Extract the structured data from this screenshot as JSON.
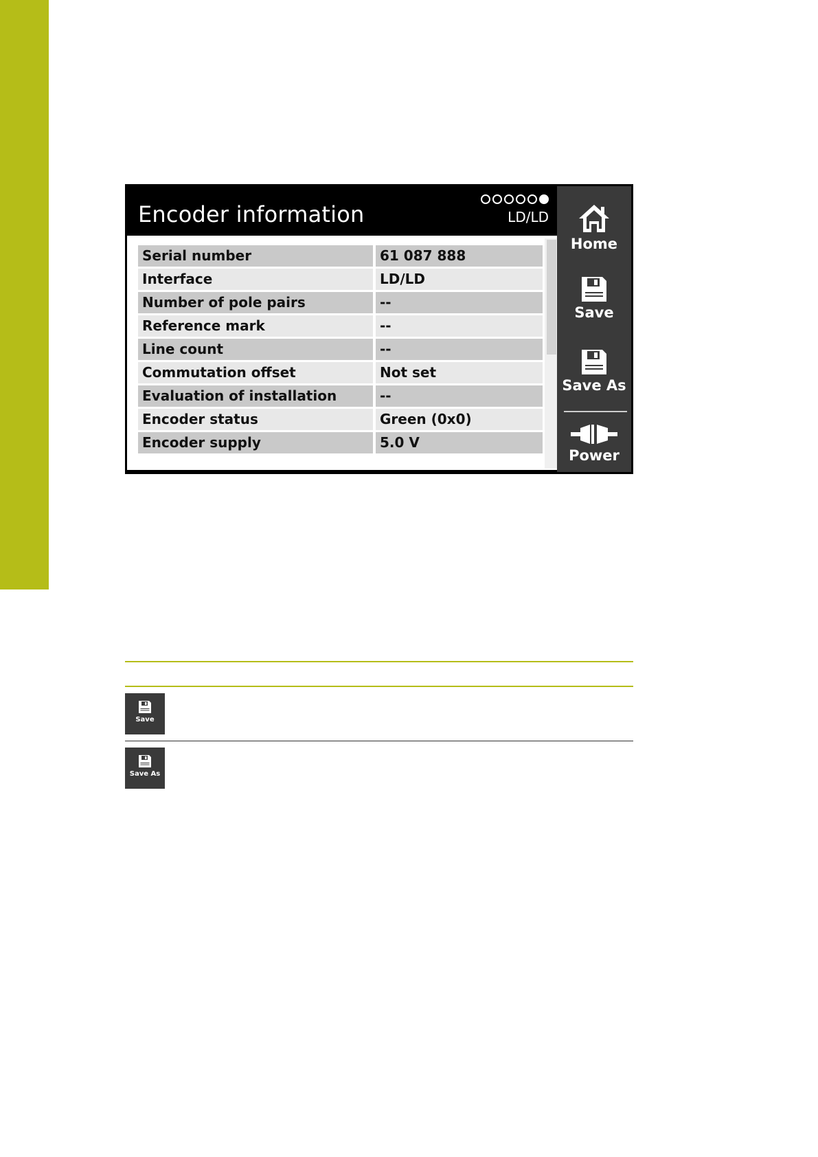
{
  "screen": {
    "title": "Encoder information",
    "interface_label": "LD/LD",
    "page_indicator": {
      "total": 6,
      "current": 6
    },
    "rows": [
      {
        "label": "Serial number",
        "value": "61 087 888"
      },
      {
        "label": "Interface",
        "value": "LD/LD"
      },
      {
        "label": "Number of pole pairs",
        "value": "--"
      },
      {
        "label": "Reference mark",
        "value": "--"
      },
      {
        "label": "Line count",
        "value": "--"
      },
      {
        "label": "Commutation offset",
        "value": "Not set"
      },
      {
        "label": "Evaluation of installation",
        "value": "--"
      },
      {
        "label": "Encoder status",
        "value": "Green (0x0)"
      },
      {
        "label": "Encoder supply",
        "value": "5.0 V"
      }
    ]
  },
  "sidebar": {
    "home_label": "Home",
    "save_label": "Save",
    "save_as_label": "Save As",
    "power_label": "Power"
  },
  "legend": {
    "save_label": "Save",
    "save_as_label": "Save As"
  },
  "colors": {
    "accent": "#b5bd18",
    "sidebar_bg": "#3a3a3a",
    "header_bg": "#000000",
    "row_dark": "#c9c9c9",
    "row_light": "#e8e8e8"
  }
}
